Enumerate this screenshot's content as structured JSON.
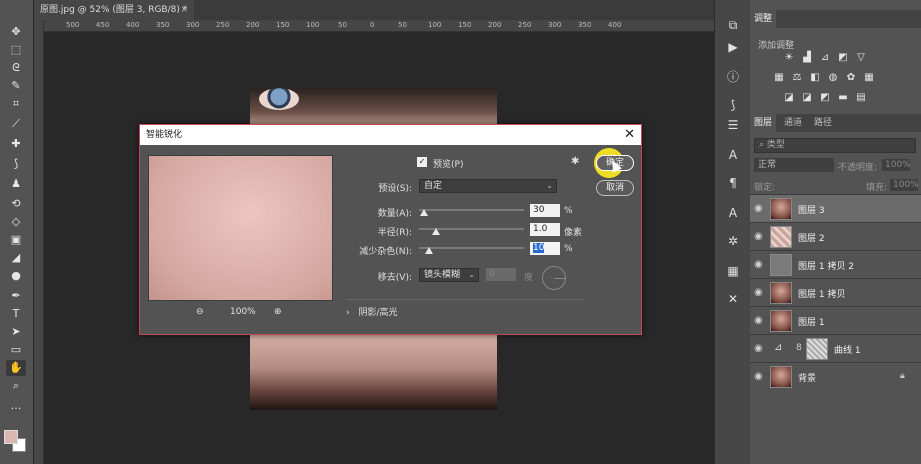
{
  "document": {
    "tab_title": "原图.jpg @ 52% (图层 3, RGB/8) *",
    "close": "×",
    "ruler_ticks": [
      "500",
      "450",
      "400",
      "350",
      "300",
      "250",
      "200",
      "150",
      "100",
      "50",
      "0",
      "50",
      "100",
      "150",
      "200",
      "250",
      "300",
      "350",
      "400"
    ]
  },
  "dialog": {
    "title": "智能锐化",
    "close": "✕",
    "preview_label": "预览(P)",
    "preview_checked": "✓",
    "preset_label": "预设(S):",
    "preset_value": "自定",
    "amount_label": "数量(A):",
    "amount_value": "30",
    "amount_unit": "%",
    "radius_label": "半径(R):",
    "radius_value": "1.0",
    "radius_unit": "像素",
    "noise_label": "减少杂色(N):",
    "noise_value": "10",
    "noise_unit": "%",
    "remove_label": "移去(V):",
    "remove_value": "镜头模糊",
    "angle_value": "0",
    "angle_unit": "度",
    "shadow_section": "阴影/高光",
    "zoom_level": "100%",
    "ok_label": "确定",
    "cancel_label": "取消"
  },
  "panels": {
    "adjust_tab": "调整",
    "adjust_sub": "添加调整",
    "layers_tab": "图层",
    "channels_tab": "通道",
    "paths_tab": "路径",
    "filter_kind": "类型",
    "blend_mode": "正常",
    "opacity_label": "不透明度:",
    "opacity_value": "100%",
    "lock_label": "锁定:",
    "fill_label": "填充:",
    "fill_value": "100%",
    "layers": [
      {
        "name": "图层 3"
      },
      {
        "name": "图层 2"
      },
      {
        "name": "图层 1 拷贝 2"
      },
      {
        "name": "图层 1 拷贝"
      },
      {
        "name": "图层 1"
      },
      {
        "name": "曲线 1"
      },
      {
        "name": "背景"
      }
    ]
  }
}
